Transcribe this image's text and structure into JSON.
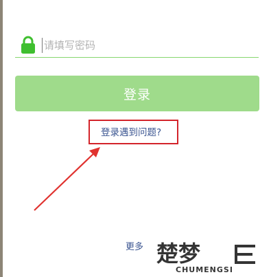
{
  "password_field": {
    "placeholder": "请填写密码",
    "value": ""
  },
  "login_button": {
    "label": "登录"
  },
  "problem_link": {
    "label": "登录遇到问题?"
  },
  "more_link": {
    "label": "更多"
  },
  "watermark": {
    "text": "楚梦",
    "subtext": "CHUMENGSI"
  },
  "colors": {
    "accent_green": "#3fbf2f",
    "button_green": "#9fdb8b",
    "underline_green": "#86d66d",
    "link_blue": "#3b5591",
    "highlight_red": "#d3232a"
  },
  "icons": {
    "field_icon": "lock-icon",
    "annotation": "arrow-icon"
  }
}
